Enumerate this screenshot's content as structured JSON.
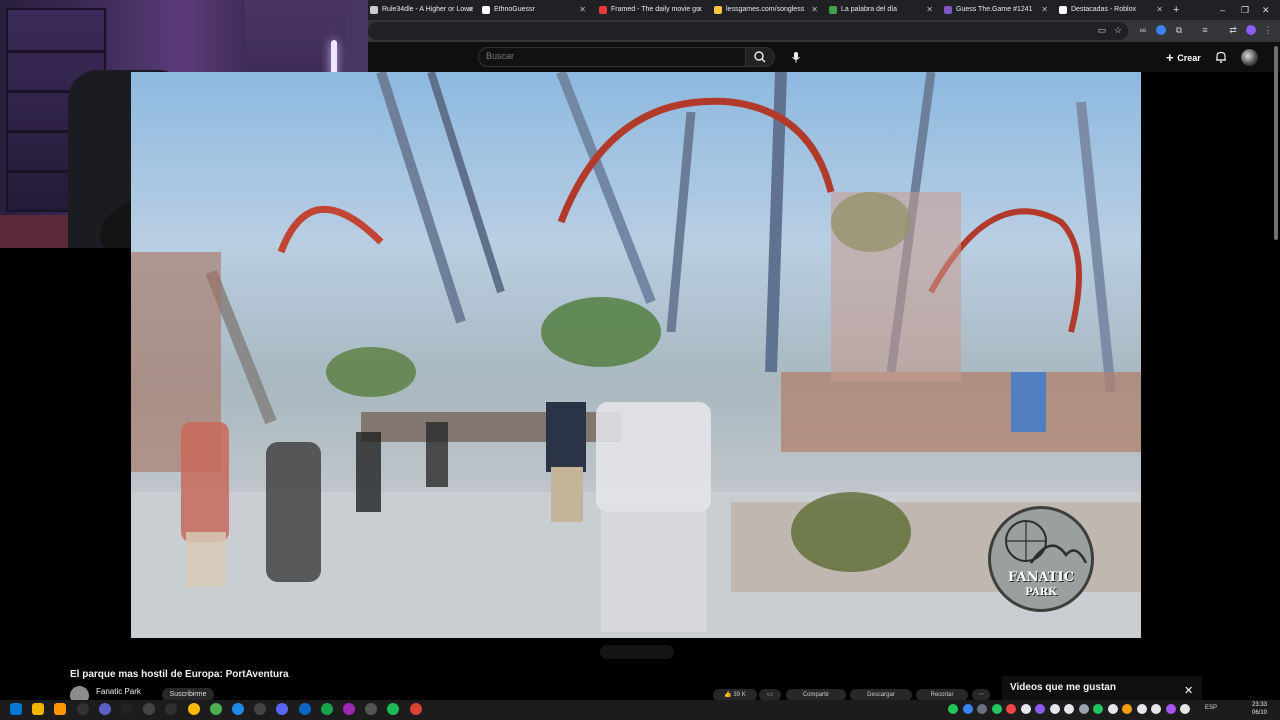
{
  "browser": {
    "tabs": [
      {
        "label": "Rule34dle - A Higher or Lowe",
        "color": "#cccccc"
      },
      {
        "label": "EthnoGuessr",
        "color": "#ffffff"
      },
      {
        "label": "Framed - The daily movie gu",
        "color": "#e53935"
      },
      {
        "label": "lessgames.com/songless",
        "color": "#f5c542"
      },
      {
        "label": "La palabra del día",
        "color": "#43a047"
      },
      {
        "label": "Guess The.Game #1241",
        "color": "#7e57c2"
      },
      {
        "label": "Destacadas - Roblox",
        "color": "#ffffff"
      }
    ],
    "new_tab": "+",
    "minimize": "–",
    "restore": "❐",
    "close": "✕"
  },
  "youtube": {
    "search_placeholder": "Buscar",
    "create_label": "Crear",
    "video_title": "El parque mas hostil de Europa: PortAventura",
    "channel_name": "Fanatic Park",
    "subscribe_label": "Suscribirme",
    "likes": "39 K",
    "share_label": "Compartir",
    "download_label": "Descargar",
    "save_label": "Recortar",
    "liked_panel_title": "Videos que me gustan",
    "logo_line1": "FANATIC",
    "logo_line2": "PARK"
  },
  "taskbar": {
    "language": "ESP",
    "time": "23:33",
    "date": "06/10"
  }
}
